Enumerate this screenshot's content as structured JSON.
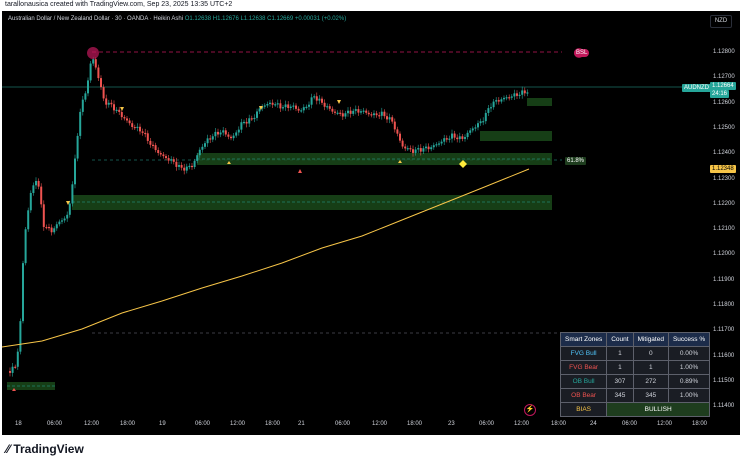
{
  "header": {
    "attribution": "tarallonausica created with TradingView.com, Sep 23, 2025 13:35 UTC+2"
  },
  "chart": {
    "title": "Australian Dollar / New Zealand Dollar · 30 · OANDA · Heikin Ashi",
    "ohlc": "O1.12638  H1.12676  L1.12638  C1.12669  +0.00031 (+0.02%)",
    "currency_button": "NZD",
    "price_labels": [
      "1.12800",
      "1.12700",
      "1.12600",
      "1.12500",
      "1.12400",
      "1.12300",
      "1.12200",
      "1.12100",
      "1.12000",
      "1.11900",
      "1.11800",
      "1.11700",
      "1.11600",
      "1.11500",
      "1.11400"
    ],
    "time_labels": [
      "18",
      "06:00",
      "12:00",
      "18:00",
      "19",
      "06:00",
      "12:00",
      "18:00",
      "21",
      "06:00",
      "12:00",
      "18:00",
      "23",
      "06:00",
      "12:00",
      "18:00",
      "24",
      "06:00",
      "12:00",
      "18:00"
    ],
    "symbol_tag": "AUDNZD",
    "last_price": "1.12664",
    "countdown": "24:16",
    "ma_price": "1.12348",
    "bsl_label": "BSL",
    "fib_label": "61.8%",
    "colors": {
      "bull": "#26a69a",
      "bear": "#ef5350",
      "ma": "#f7c548",
      "zone": "#1b4d1b",
      "background": "#000000"
    },
    "chart_data": {
      "type": "candlestick",
      "ylim": [
        1.1135,
        1.1285
      ],
      "series": [
        {
          "name": "AUDNZD",
          "values": []
        },
        {
          "name": "MA",
          "values": []
        }
      ]
    }
  },
  "smart_zones": {
    "headers": [
      "Smart Zones",
      "Count",
      "Mitigated",
      "Success %"
    ],
    "rows": [
      [
        "FVG Bull",
        "1",
        "0",
        "0.00%"
      ],
      [
        "FVG Bear",
        "1",
        "1",
        "1.00%"
      ],
      [
        "OB Bull",
        "307",
        "272",
        "0.89%"
      ],
      [
        "OB Bear",
        "345",
        "345",
        "1.00%"
      ]
    ],
    "bias_label": "BIAS",
    "bias_value": "BULLISH"
  },
  "footer": {
    "logo": "TradingView"
  }
}
